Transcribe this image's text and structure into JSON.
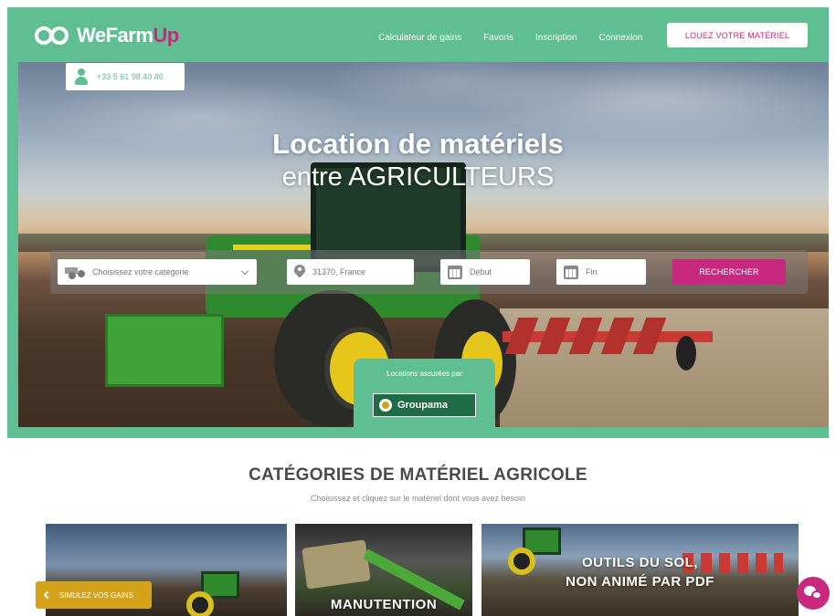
{
  "header": {
    "logo_main": "WeFarm",
    "logo_accent": "Up",
    "nav": [
      "Calculateur de gains",
      "Favoris",
      "Inscription",
      "Connexion"
    ],
    "cta": "LOUEZ VOTRE MATÉRIEL"
  },
  "contact": {
    "phone": "+33 5 61 98 40 46"
  },
  "hero": {
    "title_line1": "Location de matériels",
    "title_line2": "entre AGRICULTEURS"
  },
  "search": {
    "category": "Choisissez votre catégorie",
    "location": "31370, France",
    "start": "Début",
    "end": "Fin",
    "button": "RECHERCHER"
  },
  "insurance": {
    "label": "Locations assurées par",
    "partner": "Groupama"
  },
  "categories": {
    "title": "CATÉGORIES DE MATÉRIEL AGRICOLE",
    "subtitle": "Choisissez et cliquez sur le matériel dont vous avez besoin",
    "cards": [
      {
        "title": ""
      },
      {
        "title": "MANUTENTION"
      },
      {
        "title": "OUTILS DU SOL, NON ANIMÉ PAR PDF"
      }
    ]
  },
  "floating": {
    "simulate": "SIMULEZ VOS GAINS"
  },
  "colors": {
    "brand_green": "#5fbf92",
    "accent_pink": "#c8287e",
    "accent_gold": "#d6a21a"
  },
  "icons": [
    "logo-mark-icon",
    "user-phone-icon",
    "tractor-icon",
    "location-pin-icon",
    "calendar-icon",
    "chevron-down-icon",
    "chevron-left-icon",
    "chat-icon",
    "groupama-icon"
  ]
}
